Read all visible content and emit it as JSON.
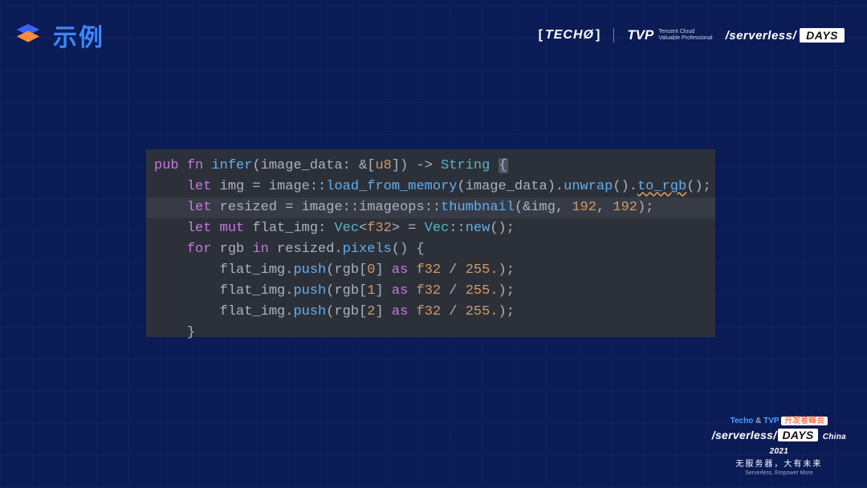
{
  "header": {
    "title": "示例",
    "brands": {
      "techo": "TECHØ",
      "tvp_bold": "TVP",
      "tvp_small_1": "Tencent Cloud",
      "tvp_small_2": "Valuable Professional",
      "serverless_prefix": "/serverless/",
      "serverless_pill": "DAYS"
    }
  },
  "code": {
    "language": "rust",
    "lines": [
      {
        "indent": 0,
        "tokens": [
          {
            "t": "kw",
            "v": "pub"
          },
          {
            "t": "sp"
          },
          {
            "t": "kw",
            "v": "fn"
          },
          {
            "t": "sp"
          },
          {
            "t": "fn",
            "v": "infer"
          },
          {
            "t": "punc",
            "v": "("
          },
          {
            "t": "id",
            "v": "image_data"
          },
          {
            "t": "punc",
            "v": ": &["
          },
          {
            "t": "type",
            "v": "u8"
          },
          {
            "t": "punc",
            "v": "]) -> "
          },
          {
            "t": "typeb",
            "v": "String"
          },
          {
            "t": "sp"
          },
          {
            "t": "bracehl",
            "v": "{"
          }
        ]
      },
      {
        "indent": 1,
        "tokens": [
          {
            "t": "let",
            "v": "let"
          },
          {
            "t": "sp"
          },
          {
            "t": "id",
            "v": "img"
          },
          {
            "t": "punc",
            "v": " = "
          },
          {
            "t": "id",
            "v": "image"
          },
          {
            "t": "punc",
            "v": "::"
          },
          {
            "t": "call",
            "v": "load_from_memory"
          },
          {
            "t": "punc",
            "v": "("
          },
          {
            "t": "id",
            "v": "image_data"
          },
          {
            "t": "punc",
            "v": ")."
          },
          {
            "t": "call",
            "v": "unwrap"
          },
          {
            "t": "punc",
            "v": "()."
          },
          {
            "t": "wavy",
            "v": "to_rgb"
          },
          {
            "t": "punc",
            "v": "();"
          }
        ]
      },
      {
        "indent": 1,
        "hl": true,
        "tokens": [
          {
            "t": "let",
            "v": "let"
          },
          {
            "t": "sp"
          },
          {
            "t": "id",
            "v": "resized"
          },
          {
            "t": "punc",
            "v": " = "
          },
          {
            "t": "id",
            "v": "image"
          },
          {
            "t": "punc",
            "v": "::"
          },
          {
            "t": "id",
            "v": "imageops"
          },
          {
            "t": "punc",
            "v": "::"
          },
          {
            "t": "call",
            "v": "thumbnail"
          },
          {
            "t": "punc",
            "v": "(&"
          },
          {
            "t": "id",
            "v": "img"
          },
          {
            "t": "punc",
            "v": ", "
          },
          {
            "t": "num",
            "v": "192"
          },
          {
            "t": "punc",
            "v": ", "
          },
          {
            "t": "num",
            "v": "192"
          },
          {
            "t": "punc",
            "v": ");"
          }
        ]
      },
      {
        "indent": 1,
        "tokens": [
          {
            "t": "let",
            "v": "let"
          },
          {
            "t": "sp"
          },
          {
            "t": "kw",
            "v": "mut"
          },
          {
            "t": "sp"
          },
          {
            "t": "id",
            "v": "flat_img"
          },
          {
            "t": "punc",
            "v": ": "
          },
          {
            "t": "typeb",
            "v": "Vec"
          },
          {
            "t": "punc",
            "v": "<"
          },
          {
            "t": "type",
            "v": "f32"
          },
          {
            "t": "punc",
            "v": "> = "
          },
          {
            "t": "typeb",
            "v": "Vec"
          },
          {
            "t": "punc",
            "v": "::"
          },
          {
            "t": "call",
            "v": "new"
          },
          {
            "t": "punc",
            "v": "();"
          }
        ]
      },
      {
        "indent": 1,
        "tokens": [
          {
            "t": "kw",
            "v": "for"
          },
          {
            "t": "sp"
          },
          {
            "t": "id",
            "v": "rgb"
          },
          {
            "t": "sp"
          },
          {
            "t": "kw",
            "v": "in"
          },
          {
            "t": "sp"
          },
          {
            "t": "id",
            "v": "resized"
          },
          {
            "t": "punc",
            "v": "."
          },
          {
            "t": "call",
            "v": "pixels"
          },
          {
            "t": "punc",
            "v": "() {"
          }
        ]
      },
      {
        "indent": 2,
        "tokens": [
          {
            "t": "id",
            "v": "flat_img"
          },
          {
            "t": "punc",
            "v": "."
          },
          {
            "t": "call",
            "v": "push"
          },
          {
            "t": "punc",
            "v": "("
          },
          {
            "t": "id",
            "v": "rgb"
          },
          {
            "t": "punc",
            "v": "["
          },
          {
            "t": "num",
            "v": "0"
          },
          {
            "t": "punc",
            "v": "] "
          },
          {
            "t": "kw",
            "v": "as"
          },
          {
            "t": "sp"
          },
          {
            "t": "type",
            "v": "f32"
          },
          {
            "t": "punc",
            "v": " / "
          },
          {
            "t": "num",
            "v": "255."
          },
          {
            "t": "punc",
            "v": ");"
          }
        ]
      },
      {
        "indent": 2,
        "tokens": [
          {
            "t": "id",
            "v": "flat_img"
          },
          {
            "t": "punc",
            "v": "."
          },
          {
            "t": "call",
            "v": "push"
          },
          {
            "t": "punc",
            "v": "("
          },
          {
            "t": "id",
            "v": "rgb"
          },
          {
            "t": "punc",
            "v": "["
          },
          {
            "t": "num",
            "v": "1"
          },
          {
            "t": "punc",
            "v": "] "
          },
          {
            "t": "kw",
            "v": "as"
          },
          {
            "t": "sp"
          },
          {
            "t": "type",
            "v": "f32"
          },
          {
            "t": "punc",
            "v": " / "
          },
          {
            "t": "num",
            "v": "255."
          },
          {
            "t": "punc",
            "v": ");"
          }
        ]
      },
      {
        "indent": 2,
        "tokens": [
          {
            "t": "id",
            "v": "flat_img"
          },
          {
            "t": "punc",
            "v": "."
          },
          {
            "t": "call",
            "v": "push"
          },
          {
            "t": "punc",
            "v": "("
          },
          {
            "t": "id",
            "v": "rgb"
          },
          {
            "t": "punc",
            "v": "["
          },
          {
            "t": "num",
            "v": "2"
          },
          {
            "t": "punc",
            "v": "] "
          },
          {
            "t": "kw",
            "v": "as"
          },
          {
            "t": "sp"
          },
          {
            "t": "type",
            "v": "f32"
          },
          {
            "t": "punc",
            "v": " / "
          },
          {
            "t": "num",
            "v": "255."
          },
          {
            "t": "punc",
            "v": ");"
          }
        ]
      },
      {
        "indent": 1,
        "tokens": [
          {
            "t": "punc",
            "v": "}"
          }
        ]
      }
    ]
  },
  "footer": {
    "line1_a": "Techo",
    "line1_b": "TVP",
    "line1_c": "开发者峰会",
    "line2_prefix": "/serverless/",
    "line2_pill": "DAYS",
    "line2_china": "China",
    "line2_year": "2021",
    "line3": "无服务器，大有未来",
    "line4": "Serverless, Empower More"
  }
}
